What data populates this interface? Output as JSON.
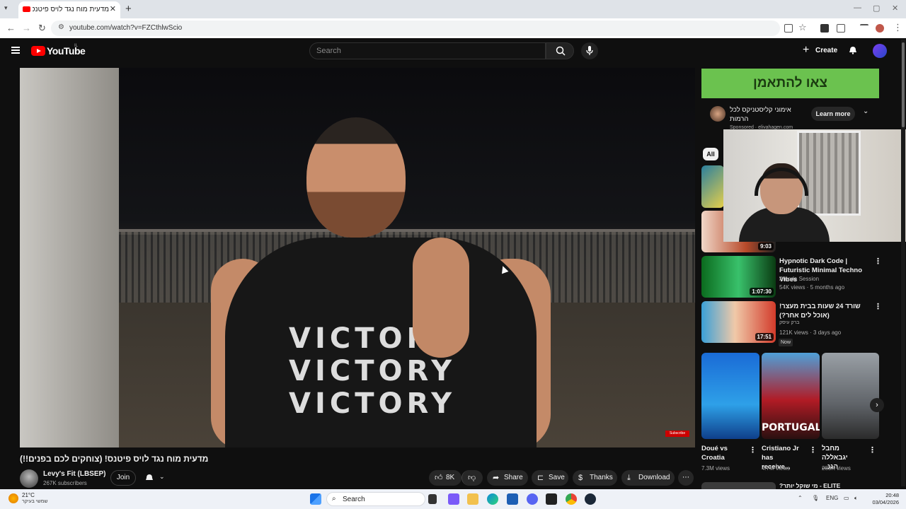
{
  "browser": {
    "tab_title": "מדעית מוח נגד לויס פיטנס!",
    "url": "youtube.com/watch?v=FZCthlwScio"
  },
  "youtube": {
    "logo_text": "YouTube",
    "country_code": "IL",
    "search_placeholder": "Search",
    "create_label": "Create"
  },
  "video": {
    "title": "מדעית מוח נגד לויס פיטנס! (צוחקים לכם בפנים!!)",
    "channel": "Levy's Fit (LBSEP)",
    "subscribers": "267K subscribers",
    "join_label": "Join",
    "likes": "8K",
    "share_label": "Share",
    "save_label": "Save",
    "thanks_label": "Thanks",
    "download_label": "Download",
    "overlay_subscribe": "Subscribe",
    "shirt_text": "VICTORY"
  },
  "ad": {
    "banner": "צאו להתאמן",
    "title": "אימוני קליסטניקס לכל הרמות",
    "sponsored": "Sponsored · elivahagen.com",
    "learn_more": "Learn more"
  },
  "chips": {
    "all": "All"
  },
  "recommendations": [
    {
      "title": "",
      "duration": "9:03"
    },
    {
      "title": "Hypnotic Dark Code | Futuristic Minimal Techno Vibes",
      "channel": "Amoda Session",
      "meta": "54K views · 5 months ago",
      "duration": "1:07:30"
    },
    {
      "title": "שורד 24 שעות בבית מעצר! (אוכל לים אחר?)",
      "channel": "ברק עיסק",
      "meta": "121K views · 3 days ago",
      "badge": "Now",
      "duration": "17:51"
    }
  ],
  "shorts": [
    {
      "title": "Doué vs Croatia",
      "views": "7.3M views"
    },
    {
      "title": "Cristiano Jr has receive...",
      "views": "4.7M views",
      "thumb_text": "PORTUGAL"
    },
    {
      "title": "מחבל יגבאללה הגנ...",
      "views": "283K views"
    }
  ],
  "next_row_title": "ELITE - מי שוקל יותר?",
  "taskbar": {
    "temp": "21°C",
    "condition": "שמשי בעיקר",
    "search": "Search",
    "lang": "ENG",
    "time": "20:48",
    "date": "03/04/2026"
  },
  "colors": {
    "yt_red": "#ff0000",
    "ad_green": "#6bc24f",
    "bg": "#0f0f0f"
  }
}
